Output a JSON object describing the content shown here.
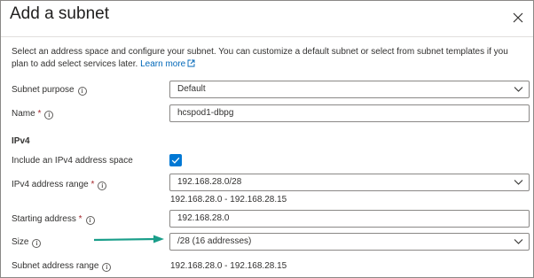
{
  "dialog": {
    "title": "Add a subnet",
    "description": "Select an address space and configure your subnet. You can customize a default subnet or select from subnet templates if you plan to add select services later.",
    "learn_more": "Learn more"
  },
  "form": {
    "subnet_purpose": {
      "label": "Subnet purpose",
      "value": "Default"
    },
    "name": {
      "label": "Name",
      "value": "hcspod1-dbpg"
    },
    "ipv4_section": "IPv4",
    "include_ipv4": {
      "label": "Include an IPv4 address space",
      "checked": true
    },
    "ipv4_range": {
      "label": "IPv4 address range",
      "value": "192.168.28.0/28",
      "hint": "192.168.28.0 - 192.168.28.15"
    },
    "starting_address": {
      "label": "Starting address",
      "value": "192.168.28.0"
    },
    "size": {
      "label": "Size",
      "value": "/28 (16 addresses)"
    },
    "subnet_address_range": {
      "label": "Subnet address range",
      "value": "192.168.28.0 - 192.168.28.15"
    }
  },
  "glyphs": {
    "required": "*",
    "info": "i"
  },
  "colors": {
    "accent": "#0078d4",
    "link": "#0067b8",
    "required": "#a4262c",
    "annotation_arrow": "#1a9e8a"
  },
  "icons": [
    "close-icon",
    "external-link-icon",
    "info-icon",
    "chevron-down-icon",
    "checkmark-icon",
    "annotation-arrow"
  ]
}
